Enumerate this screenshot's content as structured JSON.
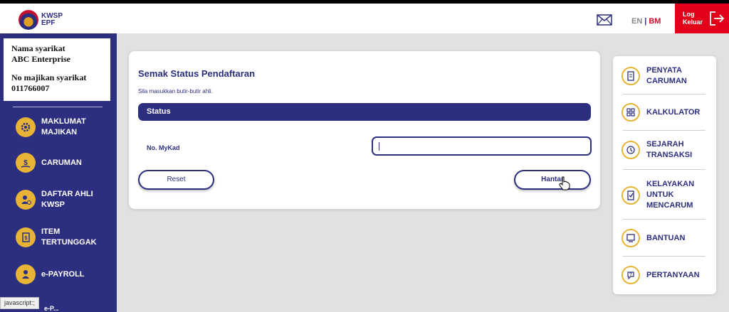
{
  "header": {
    "logo_line1": "KWSP",
    "logo_line2": "EPF",
    "lang_en": "EN",
    "lang_sep": "|",
    "lang_bm": "BM",
    "logout_label": "Log Keluar"
  },
  "company": {
    "name_label": "Nama syarikat",
    "name_value": "ABC Enterprise",
    "employer_label": "No majikan syarikat",
    "employer_value": "011766007"
  },
  "sidebar": {
    "items": [
      {
        "label": "MAKLUMAT MAJIKAN",
        "icon": "gear-icon"
      },
      {
        "label": "CARUMAN",
        "icon": "dollar-hand-icon"
      },
      {
        "label": "DAFTAR AHLI KWSP",
        "icon": "user-add-icon"
      },
      {
        "label": "ITEM TERTUNGGAK",
        "icon": "document-dollar-icon"
      },
      {
        "label": "e-PAYROLL",
        "icon": "payroll-user-icon"
      }
    ],
    "partial_item": "e-P..."
  },
  "status_bar_text": "javascript:;",
  "form": {
    "title": "Semak Status Pendaftaran",
    "subtitle": "Sila masukkan butir-butir ahli.",
    "section": "Status",
    "mykad_label": "No. MyKad",
    "mykad_value": "",
    "reset_label": "Reset",
    "submit_label": "Hantar"
  },
  "quick_links": [
    {
      "label": "PENYATA CARUMAN",
      "icon": "statement-icon"
    },
    {
      "label": "KALKULATOR",
      "icon": "calculator-icon"
    },
    {
      "label": "SEJARAH TRANSAKSI",
      "icon": "history-icon"
    },
    {
      "label": "KELAYAKAN UNTUK MENCARUM",
      "icon": "eligibility-icon"
    },
    {
      "label": "BANTUAN",
      "icon": "help-icon"
    },
    {
      "label": "PERTANYAAN",
      "icon": "question-icon"
    }
  ],
  "colors": {
    "primary": "#2c2f7f",
    "accent": "#e7b436",
    "logout": "#e3001b",
    "background": "#e1e1e1"
  }
}
